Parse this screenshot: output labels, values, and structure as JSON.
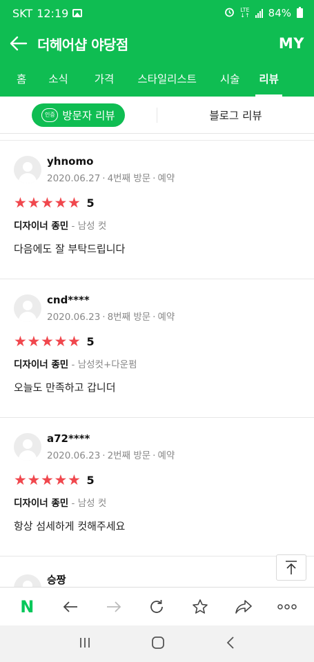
{
  "status_bar": {
    "carrier": "SKT",
    "time": "12:19",
    "network": "LTE",
    "battery": "84%"
  },
  "header": {
    "title": "더헤어샵 야당점",
    "my_label": "MY"
  },
  "tabs": [
    {
      "label": "홈"
    },
    {
      "label": "소식"
    },
    {
      "label": "가격"
    },
    {
      "label": "스타일리스트"
    },
    {
      "label": "시술"
    },
    {
      "label": "리뷰",
      "active": true
    }
  ],
  "subtabs": {
    "cert_badge": "인증",
    "visitor_label": "방문자 리뷰",
    "blog_label": "블로그 리뷰"
  },
  "reviews": [
    {
      "nickname": "yhnomo",
      "date": "2020.06.27",
      "visit": "4번째 방문",
      "type": "예약",
      "stars": 5,
      "rating_text": "5",
      "designer": "디자이너 종민",
      "service": "- 남성 컷",
      "comment": "다음에도 잘 부탁드립니다"
    },
    {
      "nickname": "cnd****",
      "date": "2020.06.23",
      "visit": "8번째 방문",
      "type": "예약",
      "stars": 5,
      "rating_text": "5",
      "designer": "디자이너 종민",
      "service": "- 남성컷+다운펌",
      "comment": "오늘도 만족하고 갑니더"
    },
    {
      "nickname": "a72****",
      "date": "2020.06.23",
      "visit": "2번째 방문",
      "type": "예약",
      "stars": 5,
      "rating_text": "5",
      "designer": "디자이너 종민",
      "service": "- 남성 컷",
      "comment": "항상 섬세하게 컷해주세요"
    }
  ],
  "partial_review": {
    "nickname": "승짱"
  },
  "colors": {
    "brand_green": "#0fbd52",
    "star_red": "#f0474d"
  },
  "icons": {
    "browser_bar": [
      "naver-logo-icon",
      "back-arrow-icon",
      "forward-arrow-icon",
      "refresh-icon",
      "bookmark-star-icon",
      "share-icon",
      "more-icon"
    ],
    "nav_bar": [
      "recent-apps-icon",
      "home-icon",
      "back-icon"
    ]
  },
  "browser_bar": {
    "logo_text": "N"
  }
}
